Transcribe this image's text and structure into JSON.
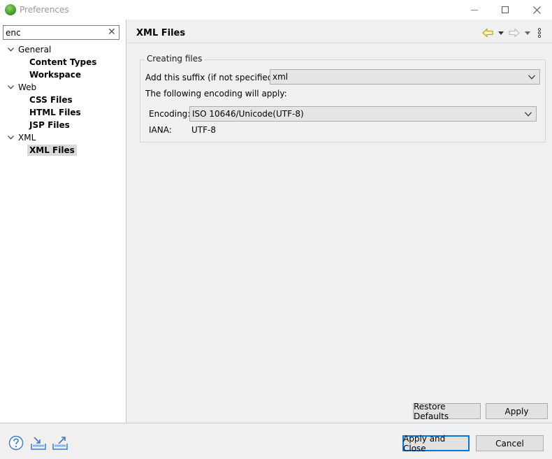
{
  "window": {
    "title": "Preferences"
  },
  "search": {
    "value": "enc",
    "clear_glyph": "✕"
  },
  "tree": {
    "general": "General",
    "content_types": "Content Types",
    "workspace": "Workspace",
    "web": "Web",
    "css_files": "CSS Files",
    "html_files": "HTML Files",
    "jsp_files": "JSP Files",
    "xml": "XML",
    "xml_files": "XML Files"
  },
  "page": {
    "title": "XML Files",
    "group_title": "Creating files",
    "suffix_label": "Add this suffix (if not specified):",
    "suffix_value": "xml",
    "encoding_note": "The following encoding will apply:",
    "encoding_label": "Encoding:",
    "encoding_value": "ISO 10646/Unicode(UTF-8)",
    "iana_label": "IANA:",
    "iana_value": "UTF-8"
  },
  "buttons": {
    "restore_defaults": "Restore Defaults",
    "apply": "Apply",
    "apply_and_close": "Apply and Close",
    "cancel": "Cancel"
  },
  "colors": {
    "accent_blue": "#0078d7",
    "nav_back": "#e8a317",
    "icon_blue": "#3a7bc8"
  }
}
